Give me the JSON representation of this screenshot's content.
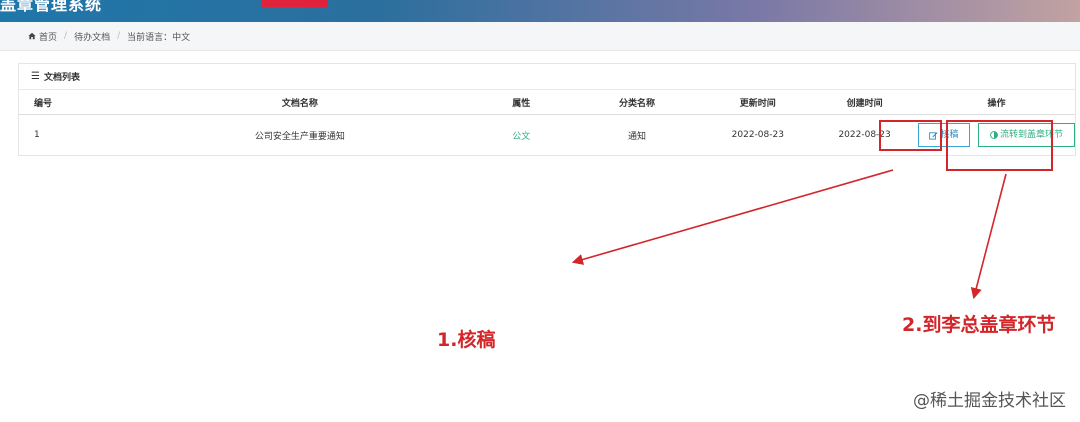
{
  "header": {
    "app_title": "盖章管理系统"
  },
  "breadcrumb": {
    "home": "首页",
    "page": "待办文档",
    "language": "当前语言：中文"
  },
  "panel": {
    "title": "文档列表"
  },
  "table": {
    "columns": [
      "编号",
      "文档名称",
      "属性",
      "分类名称",
      "更新时间",
      "创建时间",
      "操作"
    ],
    "rows": [
      {
        "id": "1",
        "name": "公司安全生产重要通知",
        "attr": "公文",
        "category": "通知",
        "updated": "2022-08-23",
        "created": "2022-08-23",
        "review_label": "核稿",
        "flow_label": "流转到盖章环节"
      }
    ]
  },
  "annotations": {
    "step1": "1.核稿",
    "step2": "2.到李总盖章环节"
  },
  "watermark": "@稀土掘金技术社区",
  "colors": {
    "annotation_red": "#d3262b",
    "accent_green": "#2cb07f",
    "accent_blue": "#2a8ec2"
  }
}
